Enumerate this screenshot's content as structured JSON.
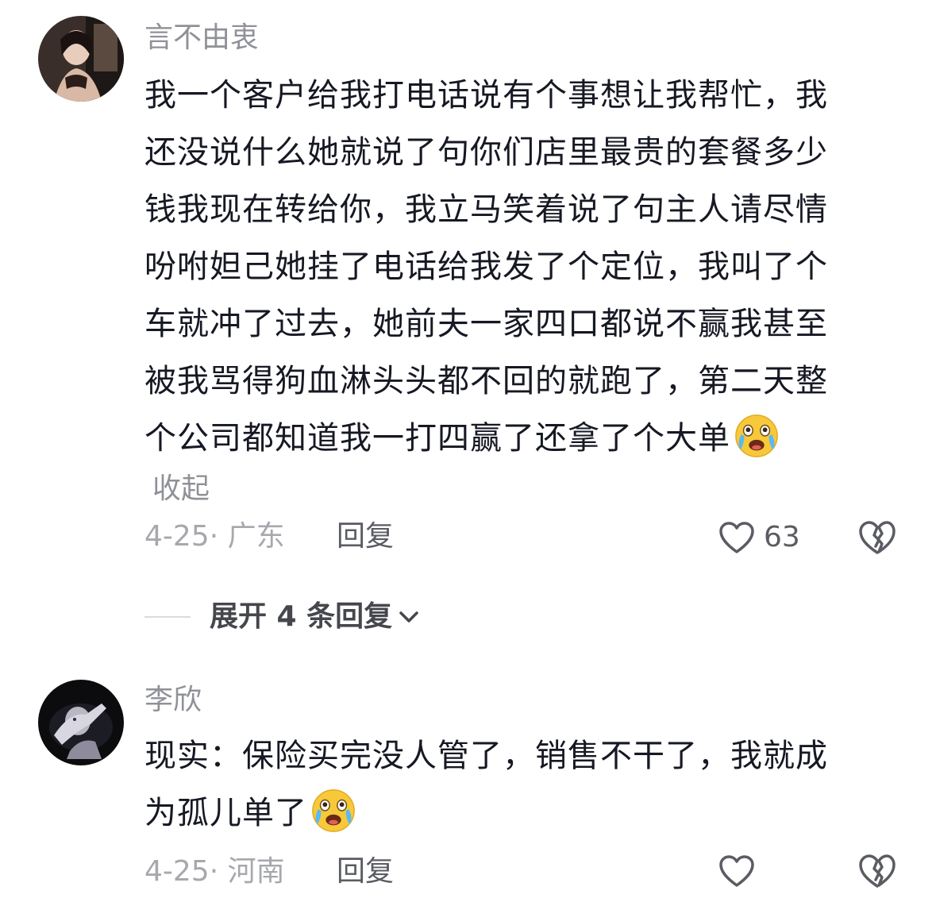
{
  "comments": [
    {
      "username": "言不由衷",
      "lines": [
        "我一个客户给我打电话说有个事想让我帮忙，我",
        "还没说什么她就说了句你们店里最贵的套餐多少",
        "钱我现在转给你，我立马笑着说了句主人请尽情",
        "吩咐妲己她挂了电话给我发了个定位，我叫了个",
        "车就冲了过去，她前夫一家四口都说不赢我甚至",
        "被我骂得狗血淋头头都不回的就跑了，第二天整",
        "个公司都知道我一打四赢了还拿了个大单"
      ],
      "emoji_icon": "crying-laughing-emoji",
      "collapse_label": "收起",
      "meta": "4-25· 广东",
      "reply_label": "回复",
      "like_count": "63",
      "expand_label": "展开 4 条回复"
    },
    {
      "username": "李欣",
      "lines": [
        "现实：保险买完没人管了，销售不干了，我就成",
        "为孤儿单了"
      ],
      "emoji_icon": "crying-laughing-emoji",
      "meta": "4-25· 河南",
      "reply_label": "回复"
    }
  ],
  "icons": {
    "like": "heart-outline-icon",
    "dislike": "broken-heart-icon",
    "expand": "chevron-down-icon"
  },
  "colors": {
    "text": "#161823",
    "secondary": "#8f9197",
    "emoji_face": "#f7c93a"
  }
}
